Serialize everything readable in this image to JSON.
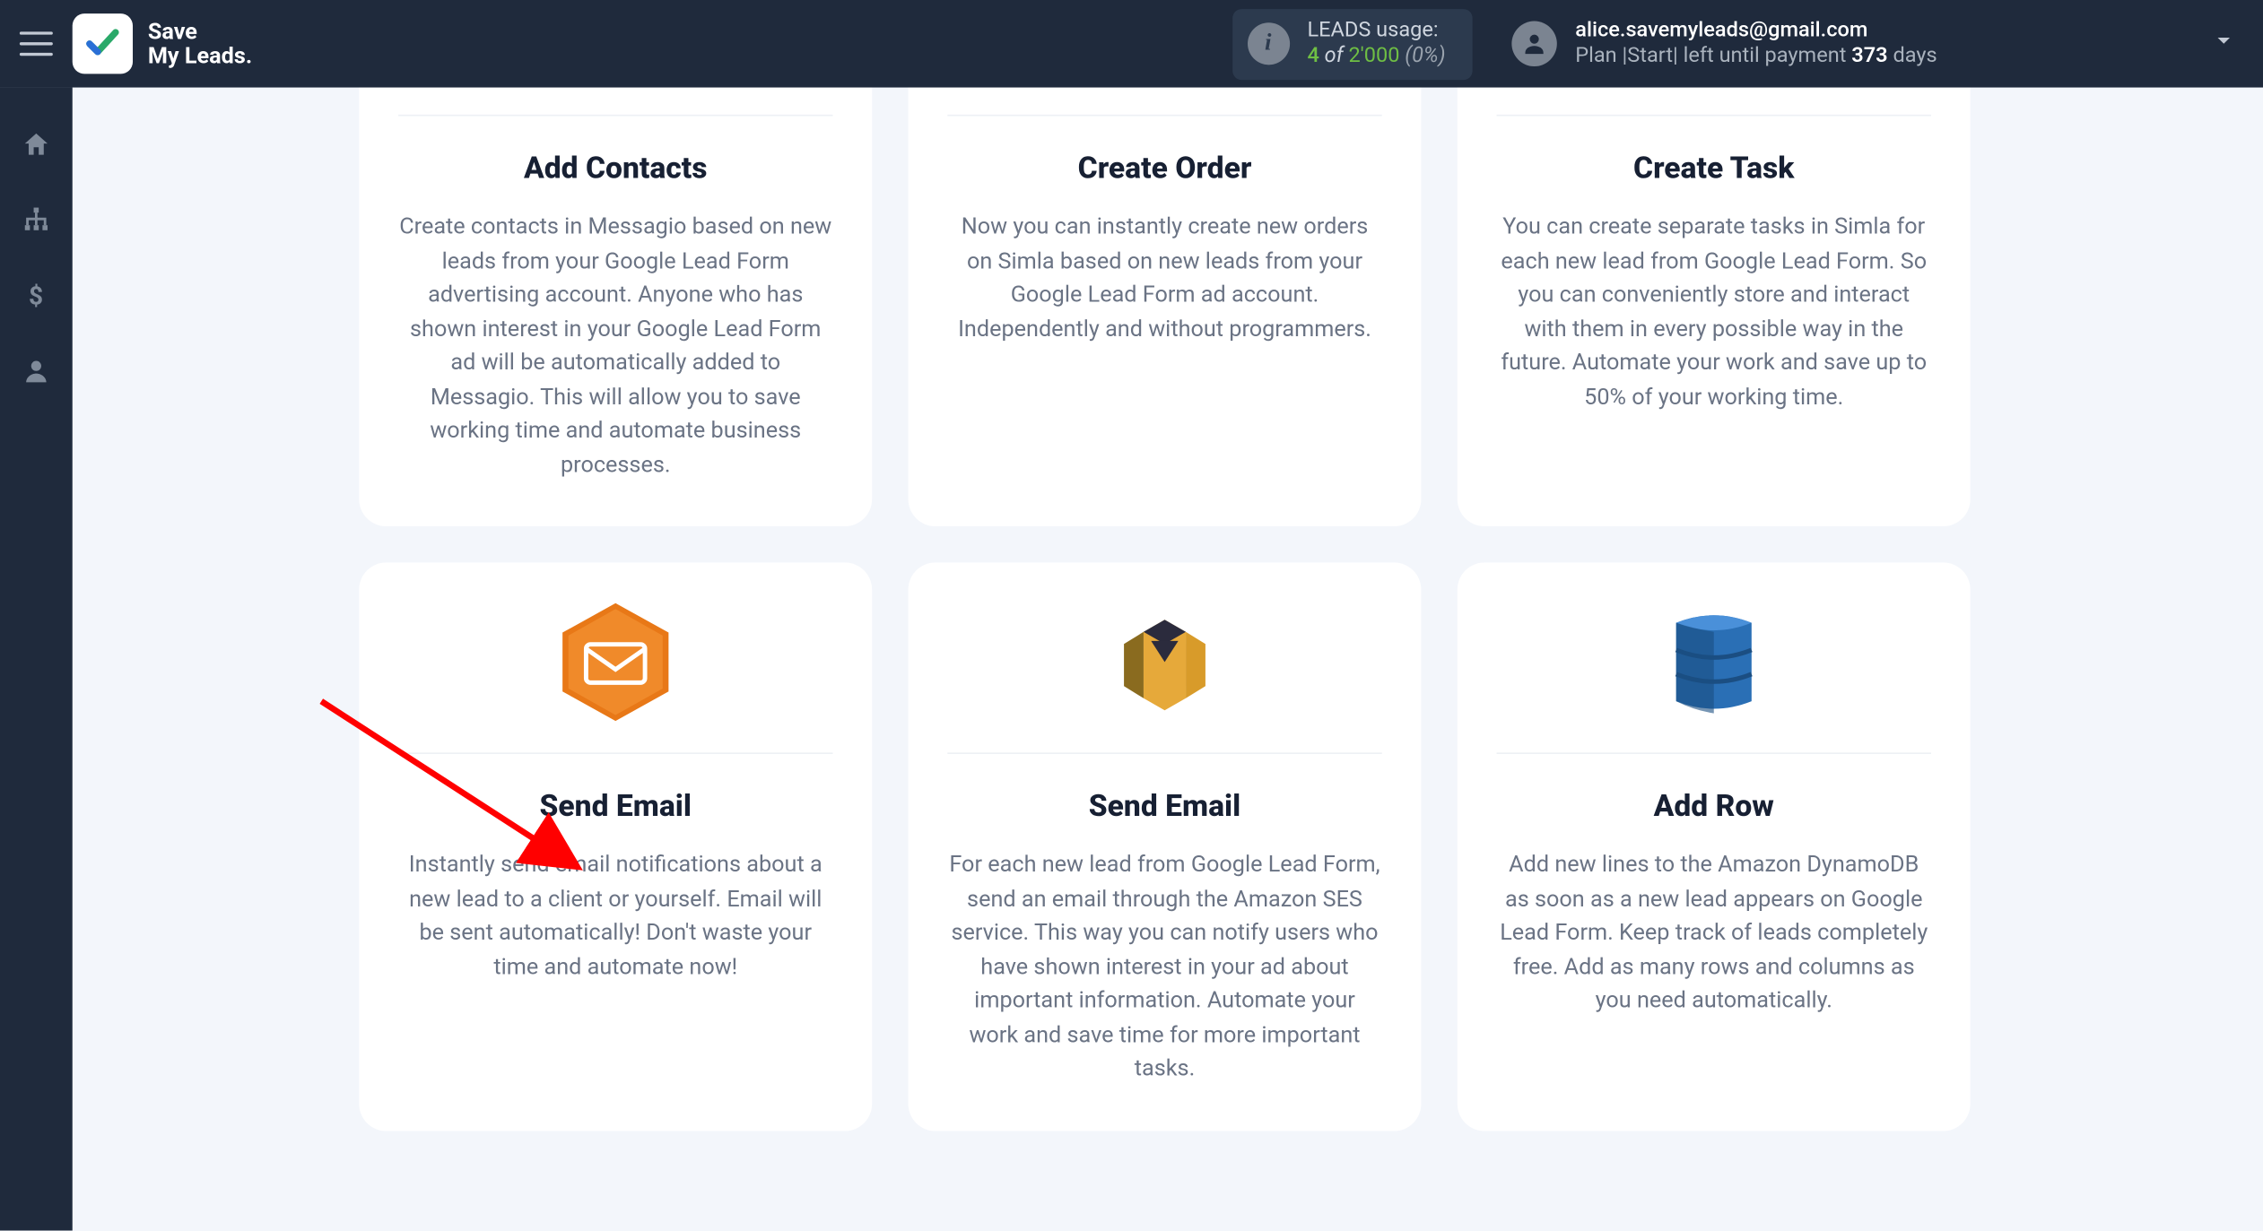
{
  "brand": {
    "line1": "Save",
    "line2": "My Leads."
  },
  "header": {
    "usage_label": "LEADS usage:",
    "usage_used": "4",
    "usage_of": " of ",
    "usage_total": "2'000",
    "usage_pct": " (0%)",
    "email": "alice.savemyleads@gmail.com",
    "plan_prefix": "Plan |Start| left until payment ",
    "plan_days": "373",
    "plan_suffix": " days"
  },
  "cards": [
    {
      "icon": "messaggio",
      "title": "Add Contacts",
      "desc": "Create contacts in Messagio based on new leads from your Google Lead Form advertising account. Anyone who has shown interest in your Google Lead Form ad will be automatically added to Messagio. This will allow you to save working time and automate business processes."
    },
    {
      "icon": "simla",
      "title": "Create Order",
      "desc": "Now you can instantly create new orders on Simla based on new leads from your Google Lead Form ad account. Independently and without programmers."
    },
    {
      "icon": "simla",
      "title": "Create Task",
      "desc": "You can create separate tasks in Simla for each new lead from Google Lead Form. So you can conveniently store and interact with them in every possible way in the future. Automate your work and save up to 50% of your working time."
    },
    {
      "icon": "hex-mail",
      "title": "Send Email",
      "desc": "Instantly send email notifications about a new lead to a client or yourself. Email will be sent automatically! Don't waste your time and automate now!"
    },
    {
      "icon": "ses",
      "title": "Send Email",
      "desc": "For each new lead from Google Lead Form, send an email through the Amazon SES service. This way you can notify users who have shown interest in your ad about important information. Automate your work and save time for more important tasks."
    },
    {
      "icon": "dynamo",
      "title": "Add Row",
      "desc": "Add new lines to the Amazon DynamoDB as soon as a new lead appears on Google Lead Form. Keep track of leads completely free. Add as many rows and columns as you need automatically."
    }
  ]
}
